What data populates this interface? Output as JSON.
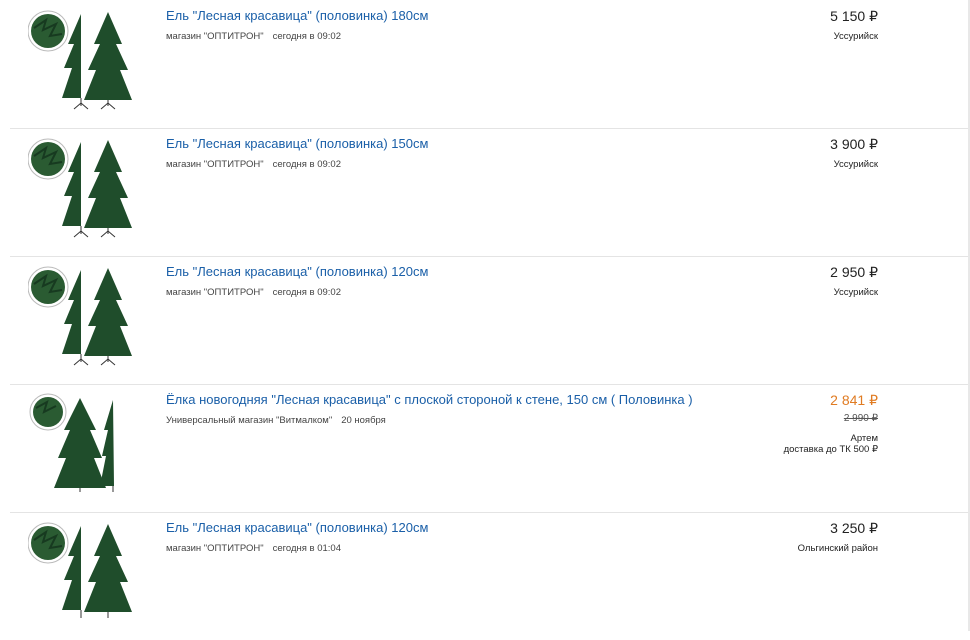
{
  "listings": [
    {
      "title": "Ель \"Лесная красавица\" (половинка) 180см",
      "shop": "магазин \"ОПТИТРОН\"",
      "date": "сегодня в 09:02",
      "price": "5 150 ₽",
      "city": "Уссурийск",
      "image": "christmas-tree-half-photo"
    },
    {
      "title": "Ель \"Лесная красавица\" (половинка) 150см",
      "shop": "магазин \"ОПТИТРОН\"",
      "date": "сегодня в 09:02",
      "price": "3 900 ₽",
      "city": "Уссурийск",
      "image": "christmas-tree-half-photo"
    },
    {
      "title": "Ель \"Лесная красавица\" (половинка) 120см",
      "shop": "магазин \"ОПТИТРОН\"",
      "date": "сегодня в 09:02",
      "price": "2 950 ₽",
      "city": "Уссурийск",
      "image": "christmas-tree-half-photo"
    },
    {
      "title": "Ёлка новогодняя \"Лесная красавица\" с плоской стороной к стене, 150 см ( Половинка )",
      "shop": "Универсальный магазин \"Витмалком\"",
      "date": "20 ноября",
      "price": "2 841 ₽",
      "old_price": "2 990 ₽",
      "city": "Артем",
      "delivery": "доставка до ТК 500 ₽",
      "image": "christmas-tree-half-photo"
    },
    {
      "title": "Ель \"Лесная красавица\" (половинка) 120см",
      "shop": "магазин \"ОПТИТРОН\"",
      "date": "сегодня в 01:04",
      "price": "3 250 ₽",
      "city": "Ольгинский район",
      "image": "christmas-tree-half-photo"
    }
  ],
  "colors": {
    "link": "#1a5fa8",
    "sale_price": "#e07b22",
    "tree_green": "#1f4d2b",
    "divider": "#e4e4e4"
  }
}
